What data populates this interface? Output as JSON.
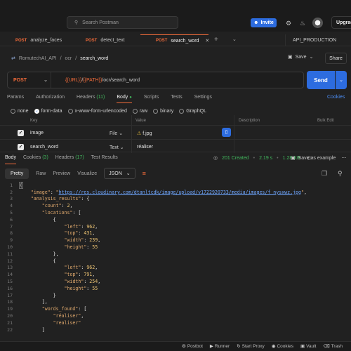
{
  "topbar": {
    "search_placeholder": "Search Postman",
    "invite_label": "Invite",
    "upgrade_label": "Upgrade"
  },
  "tabs": [
    {
      "method": "POST",
      "label": "analyze_faces"
    },
    {
      "method": "POST",
      "label": "detect_text"
    },
    {
      "method": "POST",
      "label": "search_word"
    }
  ],
  "environment": "API_PRODUCTION",
  "breadcrumb": {
    "workspace": "RomutechAI_API",
    "folder": "ocr",
    "current": "search_word"
  },
  "actions": {
    "save_label": "Save",
    "share_label": "Share"
  },
  "request": {
    "method": "POST",
    "url_var1": "{{URL}}",
    "url_sep": "/",
    "url_var2": "{{PATH}}",
    "url_rest": "/ocr/search_word",
    "send_label": "Send"
  },
  "request_tabs": {
    "params": "Params",
    "auth": "Authorization",
    "headers": "Headers",
    "headers_count": "(11)",
    "body": "Body",
    "scripts": "Scripts",
    "tests": "Tests",
    "settings": "Settings",
    "cookies": "Cookies"
  },
  "body_types": [
    "none",
    "form-data",
    "x-www-form-urlencoded",
    "raw",
    "binary",
    "GraphQL"
  ],
  "form_header": {
    "key": "Key",
    "value": "Value",
    "description": "Description",
    "bulk": "Bulk Edit"
  },
  "form_rows": [
    {
      "key": "image",
      "type": "File",
      "value": "f.jpg"
    },
    {
      "key": "search_word",
      "type": "Text",
      "value": "réaliser"
    }
  ],
  "response_tabs": {
    "body": "Body",
    "cookies": "Cookies",
    "cookies_count": "(3)",
    "headers": "Headers",
    "headers_count": "(17)",
    "tests": "Test Results"
  },
  "response_meta": {
    "status": "201 Created",
    "time": "2.19 s",
    "size": "1.28 KB",
    "save_example": "Save as example"
  },
  "response_toolbar": {
    "pretty": "Pretty",
    "raw": "Raw",
    "preview": "Preview",
    "visualize": "Visualize",
    "format": "JSON"
  },
  "code_lines": [
    "1",
    "2",
    "3",
    "4",
    "5",
    "6",
    "7",
    "8",
    "9",
    "10",
    "11",
    "12",
    "13",
    "14",
    "15",
    "16",
    "17",
    "18",
    "19",
    "20",
    "21",
    "22"
  ],
  "json": {
    "image_url": "https://res.cloudinary.com/dtanltcdk/image/upload/v1722920733/media/images/f_nysxwz.jpg",
    "count": "2",
    "loc1": {
      "left": "962",
      "top": "431",
      "width": "239",
      "height": "55"
    },
    "loc2": {
      "left": "962",
      "top": "791",
      "width": "254",
      "height": "55"
    },
    "word1": "\"réaliser\"",
    "word2": "\"realiser\""
  },
  "footer": [
    "Postbot",
    "Runner",
    "Start Proxy",
    "Cookies",
    "Vault",
    "Trash"
  ]
}
